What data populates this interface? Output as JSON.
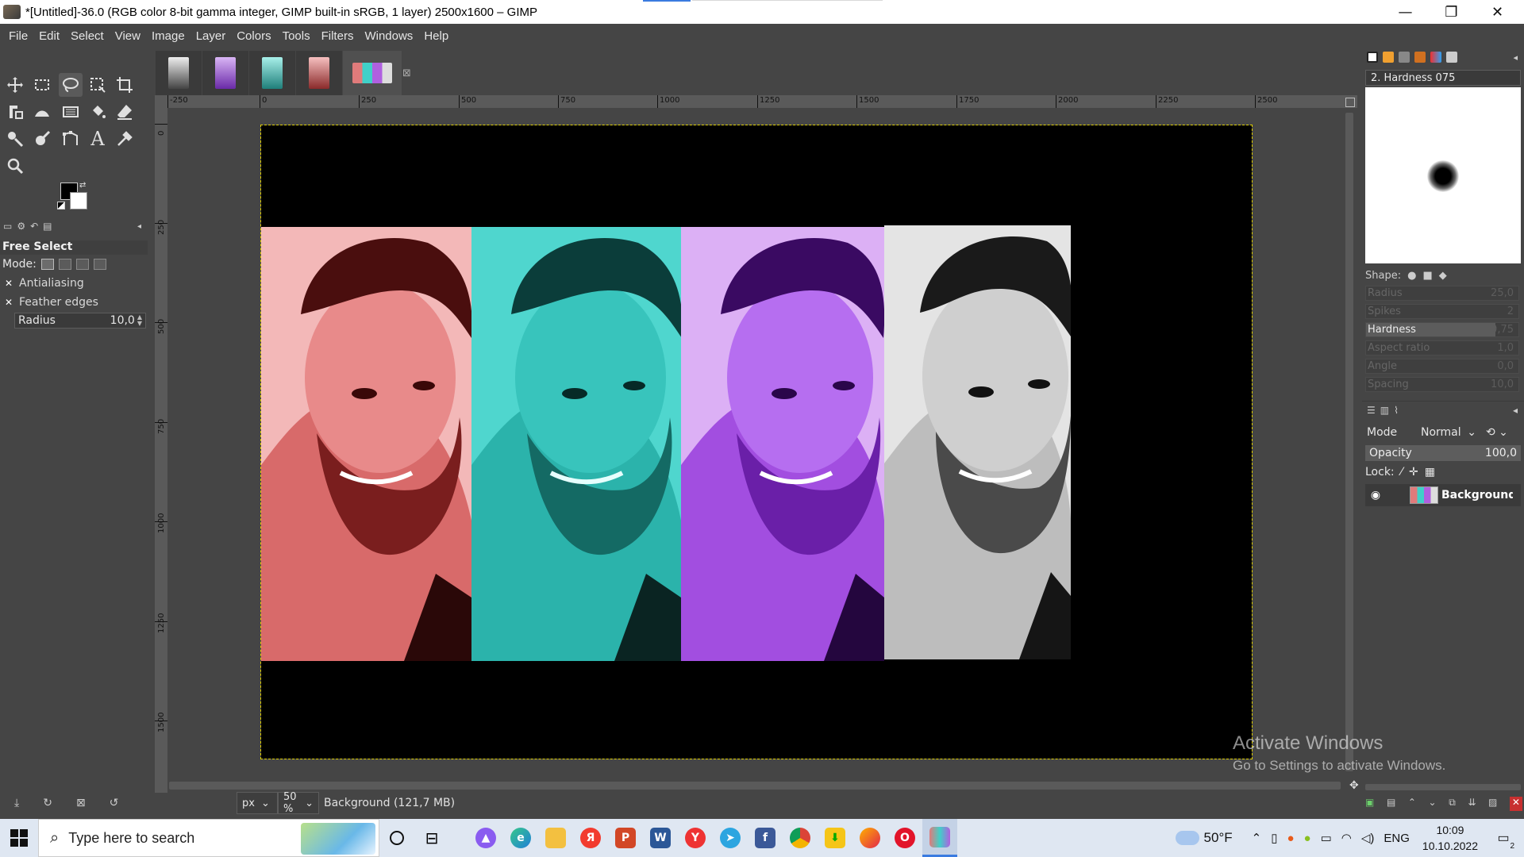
{
  "window": {
    "title": "*[Untitled]-36.0 (RGB color 8-bit gamma integer, GIMP built-in sRGB, 1 layer) 2500x1600 – GIMP",
    "minimize": "—",
    "maximize": "❐",
    "close": "✕"
  },
  "menu": [
    "File",
    "Edit",
    "Select",
    "View",
    "Image",
    "Layer",
    "Colors",
    "Tools",
    "Filters",
    "Windows",
    "Help"
  ],
  "tool_options": {
    "title": "Free Select",
    "mode_label": "Mode:",
    "antialiasing": "Antialiasing",
    "feather_edges": "Feather edges",
    "radius_label": "Radius",
    "radius_value": "10,0"
  },
  "rulers": {
    "top": [
      "-250",
      "0",
      "250",
      "500",
      "750",
      "1000",
      "1250",
      "1500",
      "1750",
      "2000",
      "2250",
      "2500"
    ],
    "left": [
      "0",
      "250",
      "500",
      "750",
      "1000",
      "1250",
      "1500"
    ]
  },
  "status": {
    "unit": "px",
    "zoom": "50 %",
    "layer_info": "Background (121,7 MB)"
  },
  "brush": {
    "name": "2. Hardness 075",
    "shape_label": "Shape:",
    "rows": [
      {
        "label": "Radius",
        "value": "25,0",
        "active": false
      },
      {
        "label": "Spikes",
        "value": "2",
        "active": false
      },
      {
        "label": "Hardness",
        "value": "0,75",
        "active": true
      },
      {
        "label": "Aspect ratio",
        "value": "1,0",
        "active": false
      },
      {
        "label": "Angle",
        "value": "0,0",
        "active": false
      },
      {
        "label": "Spacing",
        "value": "10,0",
        "active": false
      }
    ]
  },
  "layers": {
    "mode_label": "Mode",
    "mode_value": "Normal",
    "opacity_label": "Opacity",
    "opacity_value": "100,0",
    "lock_label": "Lock:",
    "layer_name": "Background"
  },
  "watermark": {
    "line1": "Activate Windows",
    "line2": "Go to Settings to activate Windows."
  },
  "taskbar": {
    "search_placeholder": "Type here to search",
    "temperature": "50°F",
    "language": "ENG",
    "time": "10:09",
    "date": "10.10.2022",
    "notifications": "2"
  },
  "colors": {
    "panel_red": "#e77a7a",
    "panel_cyan": "#3fd1c9",
    "panel_purple": "#b262e6",
    "panel_gray": "#d0d0d0",
    "selection": "#e0d000",
    "accent": "#3a7be0"
  }
}
